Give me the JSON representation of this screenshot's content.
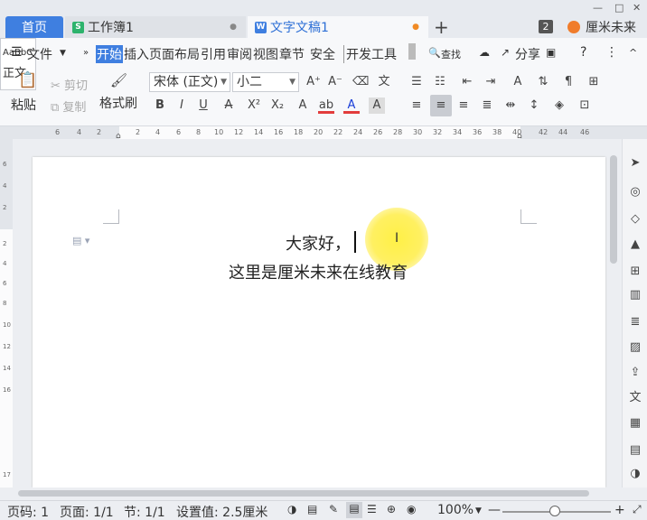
{
  "tabs": {
    "home": "首页",
    "workbook": "工作簿1",
    "document": "文字文稿1",
    "add": "+",
    "modified_mark": "●"
  },
  "window": {
    "badge": "2",
    "user": "厘米未来",
    "min": "—",
    "max": "□",
    "close": "✕"
  },
  "menu": {
    "file": "文件",
    "items": [
      "开始",
      "插入",
      "页面布局",
      "引用",
      "审阅",
      "视图",
      "章节",
      "安全",
      "开发工具"
    ],
    "search": "查找",
    "share": "分享",
    "help": "?"
  },
  "ribbon": {
    "paste": "粘贴",
    "cut": "剪切",
    "copy": "复制",
    "format_painter": "格式刷",
    "font_name": "宋体 (正文)",
    "font_size": "小二",
    "style_preview": "AaBbC",
    "style_name": "正文"
  },
  "ruler": {
    "h_ticks": [
      "6",
      "4",
      "2",
      "2",
      "4",
      "6",
      "8",
      "10",
      "12",
      "14",
      "16",
      "18",
      "20",
      "22",
      "24",
      "26",
      "28",
      "30",
      "32",
      "34",
      "36",
      "38",
      "40",
      "42",
      "44",
      "46"
    ],
    "v_ticks": [
      "6",
      "4",
      "2",
      "2",
      "4",
      "6",
      "8",
      "10",
      "12",
      "14",
      "16",
      "17"
    ]
  },
  "document": {
    "line1": "大家好，",
    "line2": "这里是厘米未来在线教育"
  },
  "status": {
    "page_no": "页码: 1",
    "pages": "页面: 1/1",
    "section": "节: 1/1",
    "setting": "设置值: 2.5厘米",
    "zoom": "100%",
    "zoom_minus": "—",
    "zoom_plus": "+"
  },
  "colors": {
    "accent": "#3f7fe0",
    "document_tab_text": "#2d6fd6",
    "highlight": "#ffee3c"
  }
}
